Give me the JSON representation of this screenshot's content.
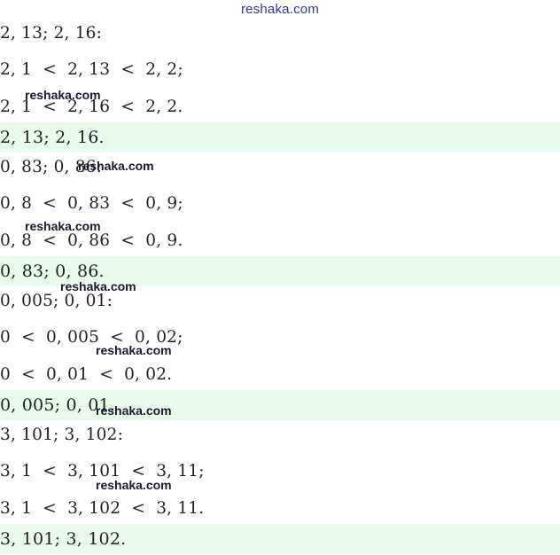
{
  "header": {
    "site_link": "reshaka.com"
  },
  "watermark": "reshaka.com",
  "blocks": [
    {
      "intro": "2, 13; 2, 16:",
      "lines": [
        "2, 1  <  2, 13  <  2, 2;",
        "2, 1  <  2, 16  <  2, 2."
      ],
      "answer": "2, 13; 2, 16."
    },
    {
      "intro": "0, 83; 0, 86:",
      "lines": [
        "0, 8  <  0, 83  <  0, 9;",
        "0, 8  <  0, 86  <  0, 9."
      ],
      "answer": "0, 83; 0, 86."
    },
    {
      "intro": "0, 005; 0, 01:",
      "lines": [
        "0  <  0, 005  <  0, 02;",
        "0  <  0, 01  <  0, 02."
      ],
      "answer": "0, 005; 0, 01."
    },
    {
      "intro": "3, 101; 3, 102:",
      "lines": [
        "3, 1  <  3, 101  <  3, 11;",
        "3, 1  <  3, 102  <  3, 11."
      ],
      "answer": "3, 101; 3, 102."
    }
  ],
  "colors": {
    "answer_band": "#e9fbec",
    "link": "#2a3aa8"
  }
}
